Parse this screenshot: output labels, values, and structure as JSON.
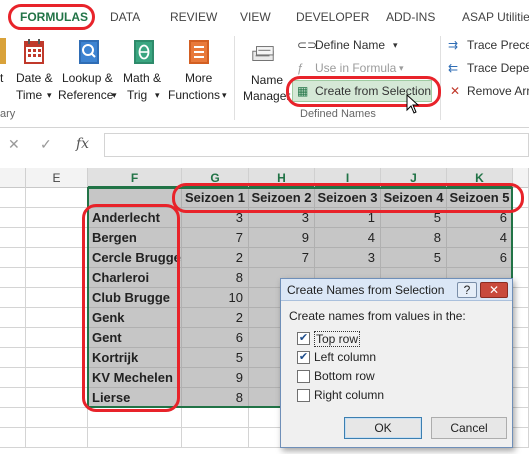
{
  "ribbon_tabs": [
    {
      "label": "FORMULAS",
      "active": true
    },
    {
      "label": "DATA"
    },
    {
      "label": "REVIEW"
    },
    {
      "label": "VIEW"
    },
    {
      "label": "DEVELOPER"
    },
    {
      "label": "ADD-INS"
    },
    {
      "label": "ASAP Utilities"
    }
  ],
  "function_library": {
    "partial_left_1": "t",
    "partial_left_2": "ary",
    "date_time": {
      "line1": "Date &",
      "line2": "Time",
      "icon": "calendar-icon"
    },
    "lookup_reference": {
      "line1": "Lookup &",
      "line2": "Reference",
      "icon": "magnifier-book-icon"
    },
    "math_trig": {
      "line1": "Math &",
      "line2": "Trig",
      "icon": "theta-book-icon"
    },
    "more_functions": {
      "line1": "More",
      "line2": "Functions",
      "icon": "more-functions-book-icon"
    }
  },
  "defined_names": {
    "name_manager": {
      "line1": "Name",
      "line2": "Manager",
      "icon": "name-tags-icon"
    },
    "define_name": "Define Name",
    "use_in_formula": "Use in Formula",
    "create_from_selection": "Create from Selection",
    "group_label": "Defined Names"
  },
  "formula_auditing": {
    "trace_precedents": "Trace Preced",
    "trace_dependents": "Trace Depe",
    "remove_arrows": "Remove Arro"
  },
  "formula_bar": {
    "cancel_symbol": "✕",
    "enter_symbol": "✓",
    "fx_symbol": "fx",
    "value": ""
  },
  "columns": [
    "E",
    "F",
    "G",
    "H",
    "I",
    "J",
    "K"
  ],
  "header_row": [
    "Seizoen 1",
    "Seizoen 2",
    "Seizoen 3",
    "Seizoen 4",
    "Seizoen 5"
  ],
  "rows": [
    {
      "name": "Anderlecht",
      "values": [
        "3",
        "3",
        "1",
        "5",
        "6"
      ]
    },
    {
      "name": "Bergen",
      "values": [
        "7",
        "9",
        "4",
        "8",
        "4"
      ]
    },
    {
      "name": "Cercle Brugge",
      "values": [
        "2",
        "7",
        "3",
        "5",
        "6"
      ]
    },
    {
      "name": "Charleroi",
      "values": [
        "8",
        "",
        "",
        "",
        ""
      ]
    },
    {
      "name": "Club Brugge",
      "values": [
        "10",
        "",
        "",
        "",
        ""
      ]
    },
    {
      "name": "Genk",
      "values": [
        "2",
        "",
        "",
        "",
        ""
      ]
    },
    {
      "name": "Gent",
      "values": [
        "6",
        "",
        "",
        "",
        ""
      ]
    },
    {
      "name": "Kortrijk",
      "values": [
        "5",
        "",
        "",
        "",
        ""
      ]
    },
    {
      "name": "KV Mechelen",
      "values": [
        "9",
        "",
        "",
        "",
        ""
      ]
    },
    {
      "name": "Lierse",
      "values": [
        "8",
        "",
        "",
        "",
        ""
      ]
    }
  ],
  "dialog": {
    "title": "Create Names from Selection",
    "help": "?",
    "close": "✕",
    "prompt": "Create names from values in the:",
    "options": [
      {
        "label": "Top row",
        "checked": true
      },
      {
        "label": "Left column",
        "checked": true
      },
      {
        "label": "Bottom row",
        "checked": false
      },
      {
        "label": "Right column",
        "checked": false
      }
    ],
    "ok": "OK",
    "cancel": "Cancel"
  },
  "colors": {
    "excel_green": "#217346",
    "highlight_red": "#e8232a",
    "selection_gray": "#c6c6c6"
  }
}
